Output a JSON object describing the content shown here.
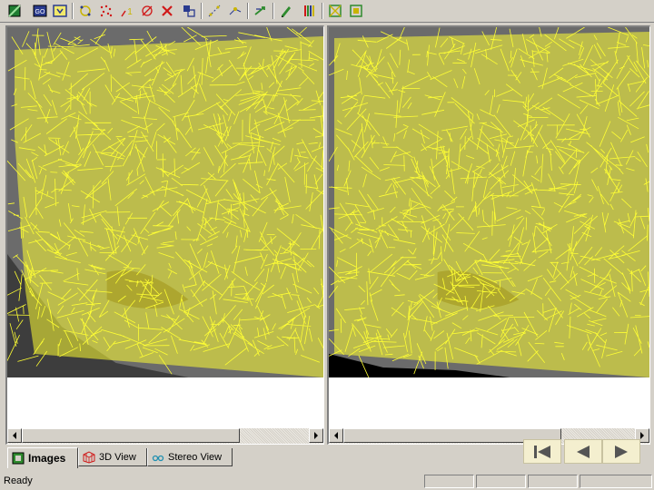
{
  "toolbar": {
    "icons": [
      "green-square-icon",
      "go-icon",
      "arrow-down-icon",
      "circle-points-icon",
      "scatter-points-icon",
      "triangle-one-icon",
      "target-icon",
      "red-x-icon",
      "align-squares-icon",
      "dotted-line-icon",
      "connect-points-icon",
      "green-arrows-icon",
      "pen-icon",
      "color-bars-icon",
      "frame-cross-icon",
      "frame-cross-2-icon"
    ]
  },
  "tabs": {
    "images": {
      "label": "Images",
      "icon": "image-tab-icon"
    },
    "view3d": {
      "label": "3D View",
      "icon": "3d-grid-icon"
    },
    "stereo": {
      "label": "Stereo View",
      "icon": "stereo-glasses-icon"
    }
  },
  "nav": {
    "first": "skip-to-start-icon",
    "prev": "previous-icon",
    "next": "next-icon"
  },
  "status": {
    "text": "Ready"
  },
  "colors": {
    "mesh": "#ffff33",
    "background": "#d4d0c8"
  }
}
